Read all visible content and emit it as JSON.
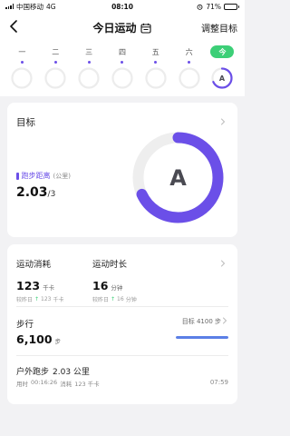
{
  "status": {
    "carrier": "中国移动",
    "network": "4G",
    "time": "08:10",
    "battery_text": "71%",
    "battery_level": 0.71
  },
  "nav": {
    "title": "今日运动",
    "action": "调整目标",
    "back_icon": "chevron-left-icon",
    "calendar_icon": "calendar-icon"
  },
  "week": [
    {
      "label": "一",
      "active": false,
      "dot": true
    },
    {
      "label": "二",
      "active": false,
      "dot": true
    },
    {
      "label": "三",
      "active": false,
      "dot": true
    },
    {
      "label": "四",
      "active": false,
      "dot": true
    },
    {
      "label": "五",
      "active": false,
      "dot": true
    },
    {
      "label": "六",
      "active": false,
      "dot": true
    },
    {
      "label": "今",
      "active": true,
      "dot": false,
      "grade": "A",
      "progress": 0.68
    }
  ],
  "goal": {
    "title": "目标",
    "metric_label": "跑步距离",
    "metric_unit": "(公里)",
    "value": "2.03",
    "target": "/3",
    "grade": "A",
    "progress": 0.68,
    "ring_color": "#6b4fe8",
    "track_color": "#eeeeee"
  },
  "stats": {
    "calories": {
      "label": "运动消耗",
      "value": "123",
      "unit": "千卡",
      "compare_label": "较昨日",
      "compare_value": "123",
      "compare_unit": "千卡"
    },
    "duration": {
      "label": "运动时长",
      "value": "16",
      "unit": "分钟",
      "compare_label": "较昨日",
      "compare_value": "16",
      "compare_unit": "分钟"
    }
  },
  "steps": {
    "label": "步行",
    "goal_text": "目标 4100 步",
    "value": "6,100",
    "unit": "步",
    "progress": 1.0
  },
  "run": {
    "title": "户外跑步",
    "distance": "2.03 公里",
    "duration_label": "用时",
    "duration": "00:16:26",
    "cal_label": "消耗",
    "cal": "123 千卡",
    "time": "07:59"
  },
  "colors": {
    "accent": "#6b4fe8",
    "today": "#3ccf77",
    "steps_bar": "#5b7fe6"
  }
}
